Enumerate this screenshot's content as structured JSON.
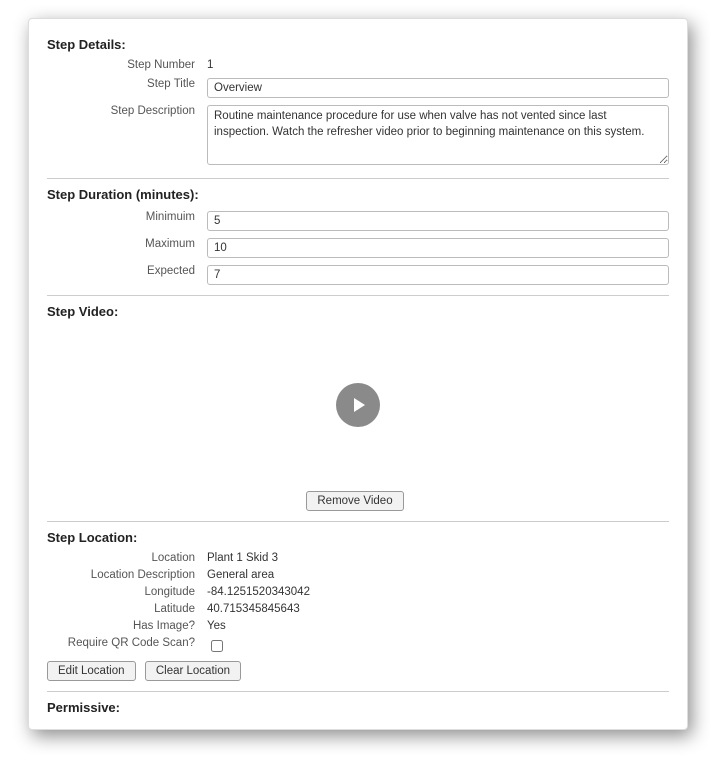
{
  "sections": {
    "details": {
      "title": "Step Details:",
      "step_number_label": "Step Number",
      "step_number_value": "1",
      "step_title_label": "Step Title",
      "step_title_value": "Overview",
      "step_description_label": "Step Description",
      "step_description_value": "Routine maintenance procedure for use when valve has not vented since last inspection. Watch the refresher video prior to beginning maintenance on this system."
    },
    "duration": {
      "title": "Step Duration (minutes):",
      "minimum_label": "Minimuim",
      "minimum_value": "5",
      "maximum_label": "Maximum",
      "maximum_value": "10",
      "expected_label": "Expected",
      "expected_value": "7"
    },
    "video": {
      "title": "Step Video:",
      "remove_button": "Remove Video"
    },
    "location": {
      "title": "Step Location:",
      "location_label": "Location",
      "location_value": "Plant 1 Skid 3",
      "desc_label": "Location Description",
      "desc_value": "General area",
      "longitude_label": "Longitude",
      "longitude_value": "-84.1251520343042",
      "latitude_label": "Latitude",
      "latitude_value": "40.715345845643",
      "has_image_label": "Has Image?",
      "has_image_value": "Yes",
      "require_qr_label": "Require QR Code Scan?",
      "edit_button": "Edit Location",
      "clear_button": "Clear Location"
    },
    "permissive": {
      "title": "Permissive:"
    }
  }
}
